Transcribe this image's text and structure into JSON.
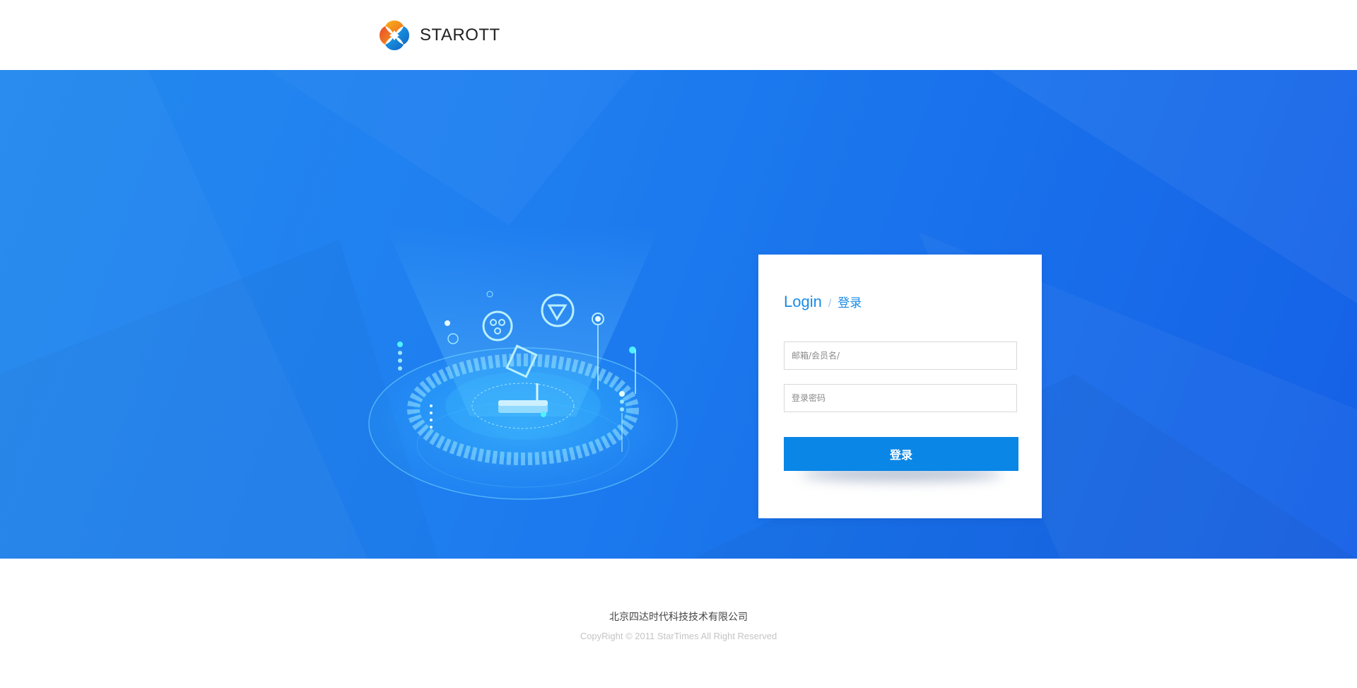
{
  "header": {
    "brand_name": "STAROTT",
    "logo_icon": "starott-logo-icon"
  },
  "login": {
    "title_en": "Login",
    "title_separator": "/",
    "title_cn": "登录",
    "username_placeholder": "邮箱/会员名/",
    "username_value": "",
    "password_placeholder": "登录密码",
    "password_value": "",
    "submit_label": "登录"
  },
  "illustration": {
    "icon": "router-streaming-illustration"
  },
  "footer": {
    "company": "北京四达时代科技技术有限公司",
    "copyright": "CopyRight © 2011 StarTimes All Right Reserved"
  },
  "colors": {
    "accent": "#1a8be6",
    "button": "#0a86e6",
    "hero_bg": "#1f7ff0"
  }
}
